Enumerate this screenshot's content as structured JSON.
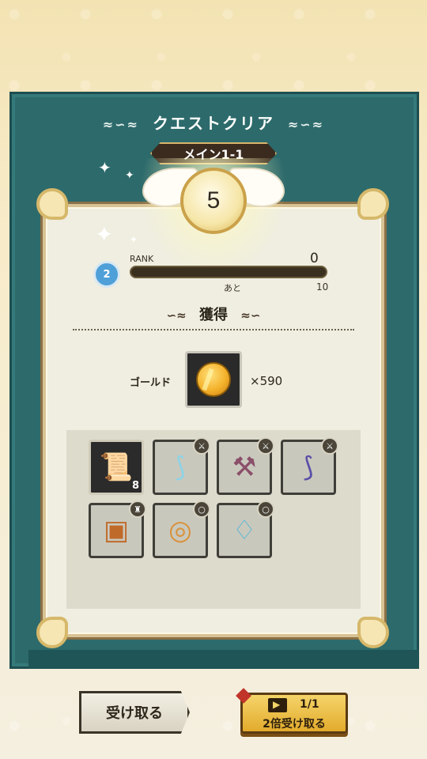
{
  "screen": {
    "title": "クエストクリア",
    "stage": "メイン1-1",
    "clear_medal_value": "5"
  },
  "rank": {
    "badge": "2",
    "label": "RANK",
    "current_exp": "0",
    "next_label": "あと",
    "next_value": "10",
    "progress_fraction": 0
  },
  "rewards": {
    "section_title": "獲得",
    "gold_label": "ゴールド",
    "gold_count": "×590",
    "items": [
      {
        "name": "scroll-icon",
        "qty": "8",
        "badge": ""
      },
      {
        "name": "scythe-icon",
        "qty": "",
        "badge": "weapon"
      },
      {
        "name": "hammer-icon",
        "qty": "",
        "badge": "weapon"
      },
      {
        "name": "dark-scythe-icon",
        "qty": "",
        "badge": "weapon"
      },
      {
        "name": "armor-icon",
        "qty": "",
        "badge": "armor"
      },
      {
        "name": "ring-icon",
        "qty": "",
        "badge": "ring"
      },
      {
        "name": "necklace-icon",
        "qty": "",
        "badge": "necklace"
      }
    ]
  },
  "buttons": {
    "receive": "受け取る",
    "double_count": "1/1",
    "double_receive": "2倍受け取る"
  },
  "colors": {
    "panel": "#2d6a6b",
    "card": "#efeee0",
    "gold_button": "#e2ab2c"
  }
}
